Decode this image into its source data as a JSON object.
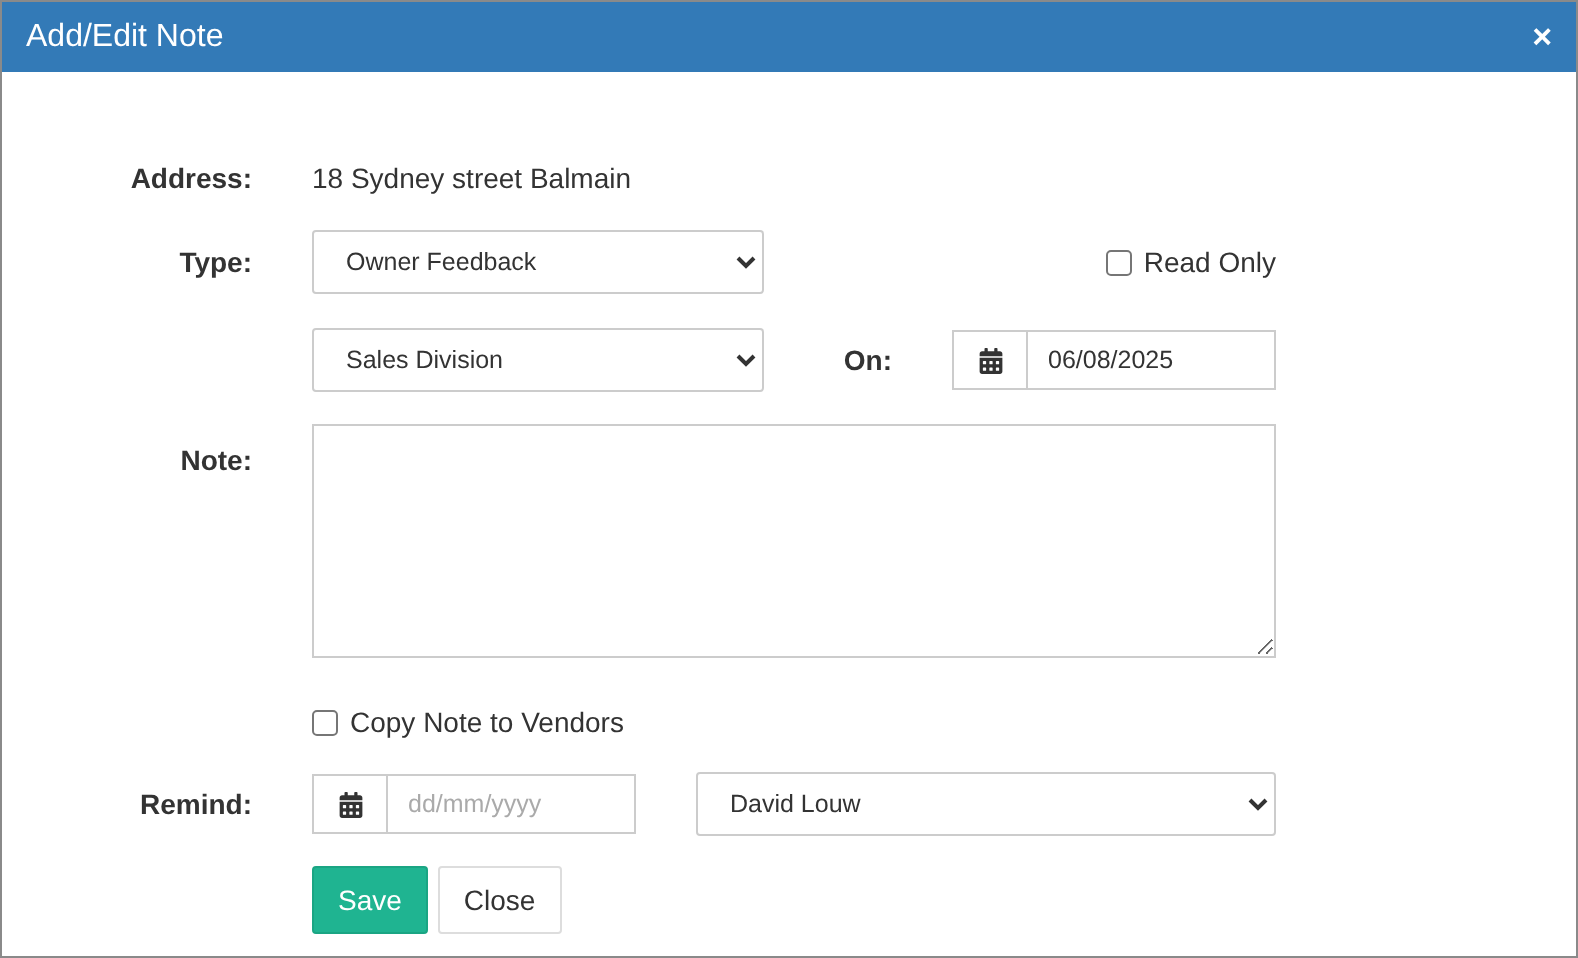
{
  "dialog": {
    "title": "Add/Edit Note",
    "close": "×"
  },
  "address": {
    "label": "Address:",
    "value": "18 Sydney street Balmain"
  },
  "type": {
    "label": "Type:",
    "value": "Owner Feedback"
  },
  "read_only": {
    "label": "Read Only",
    "checked": false
  },
  "division": {
    "value": "Sales Division"
  },
  "on": {
    "label": "On:",
    "value": "06/08/2025"
  },
  "note": {
    "label": "Note:"
  },
  "copy_to_vendors": {
    "label": "Copy Note to Vendors",
    "checked": false
  },
  "remind": {
    "label": "Remind:",
    "placeholder": "dd/mm/yyyy",
    "assignee": "David Louw"
  },
  "buttons": [
    {
      "label": "Save",
      "kind": "primary"
    },
    {
      "label": "Close",
      "kind": "default"
    }
  ]
}
